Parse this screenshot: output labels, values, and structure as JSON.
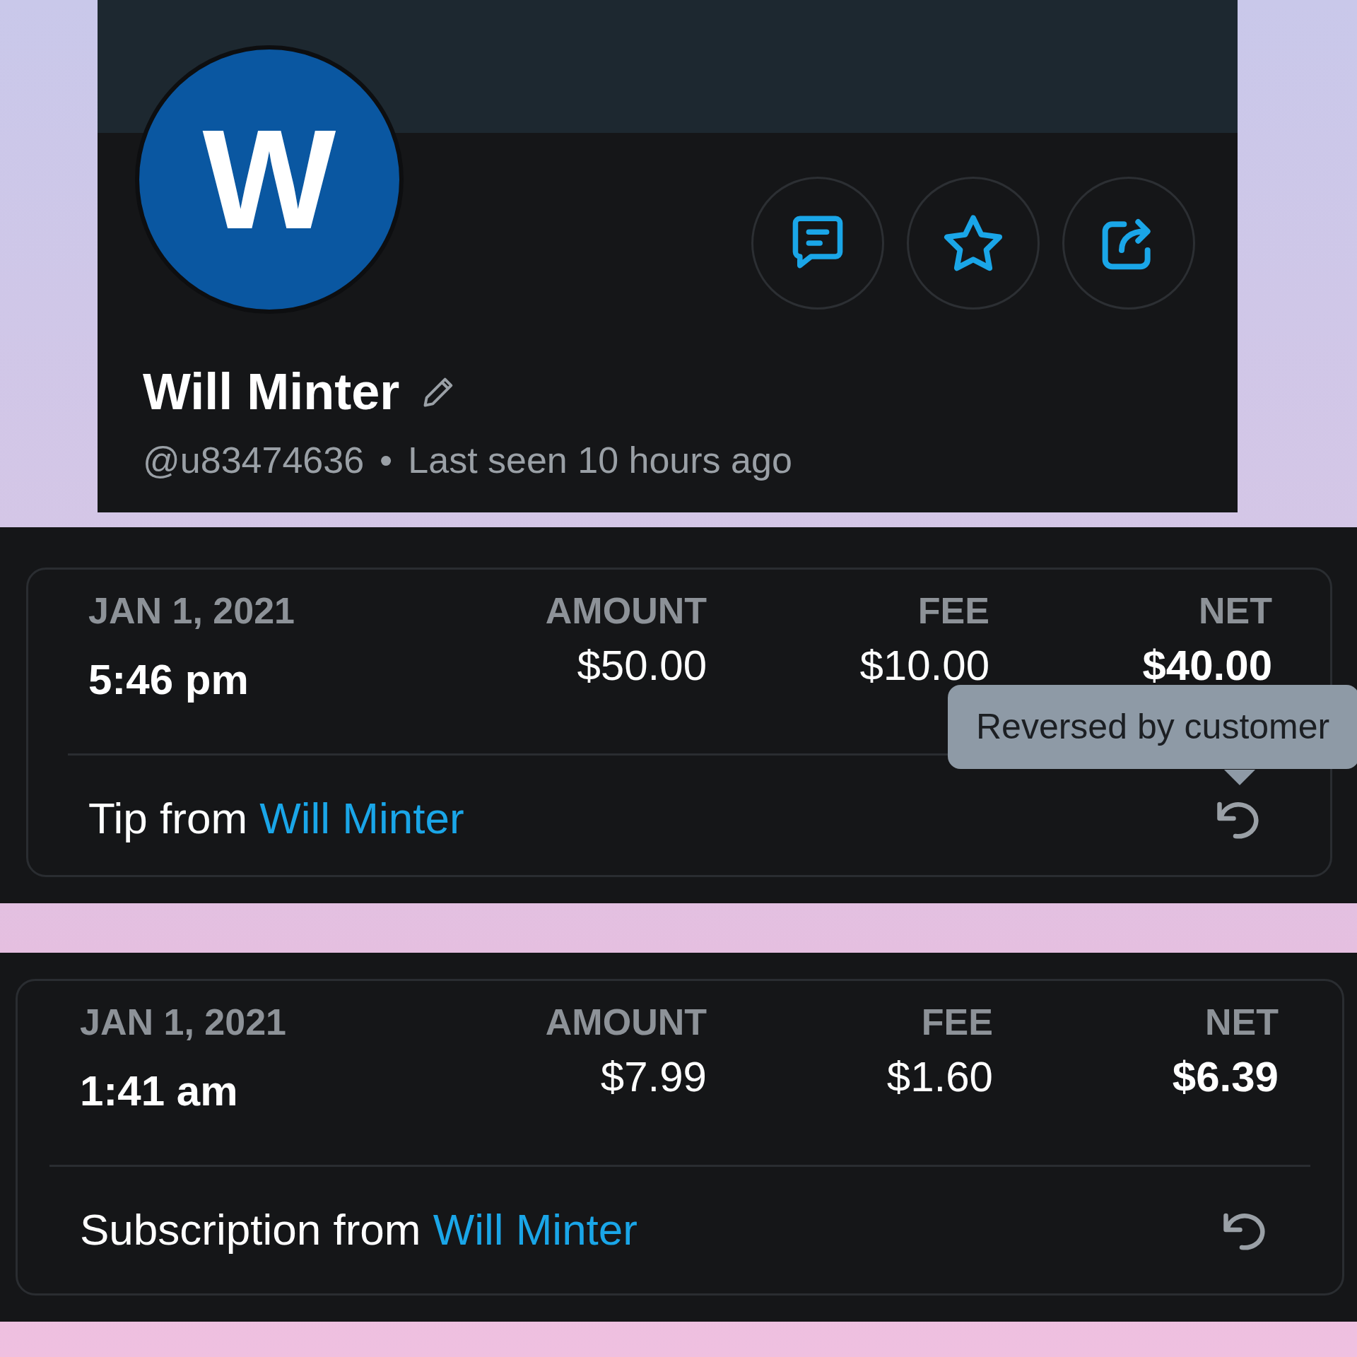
{
  "profile": {
    "avatar_letter": "W",
    "name": "Will Minter",
    "handle": "@u83474636",
    "separator": "•",
    "last_seen": "Last seen 10 hours ago"
  },
  "transactions": [
    {
      "date": "JAN 1, 2021",
      "time": "5:46 pm",
      "columns": [
        {
          "label": "AMOUNT",
          "value": "$50.00"
        },
        {
          "label": "FEE",
          "value": "$10.00"
        },
        {
          "label": "NET",
          "value": "$40.00"
        }
      ],
      "description": "Tip from",
      "from": "Will Minter",
      "tooltip": "Reversed by customer"
    },
    {
      "date": "JAN 1, 2021",
      "time": "1:41 am",
      "columns": [
        {
          "label": "AMOUNT",
          "value": "$7.99"
        },
        {
          "label": "FEE",
          "value": "$1.60"
        },
        {
          "label": "NET",
          "value": "$6.39"
        }
      ],
      "description": "Subscription from",
      "from": "Will Minter"
    }
  ]
}
